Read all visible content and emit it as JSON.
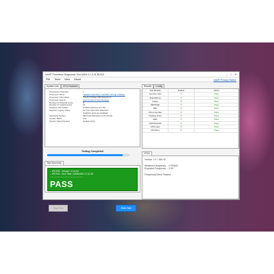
{
  "window": {
    "title": "Intel® Processor Diagnostic Tool 64bit 4.1.8.41 BUILD",
    "controls": [
      "–",
      "□",
      "✕"
    ]
  },
  "menu": {
    "items": [
      "File",
      "Tools",
      "View",
      "About"
    ],
    "privacy_notice": "Intel® Privacy Notice"
  },
  "left_tabs": [
    "System Info",
    "CPU Features"
  ],
  "system_info": [
    {
      "k": "Processors Detected",
      "v": "1",
      "link": false
    },
    {
      "k": "Processor Name",
      "v": "Intel(R) Core(TM) i7-10700F CPU @ 2.90GHz",
      "link": true
    },
    {
      "k": "Processor Information",
      "v": "Family 6 Model 165 Stepping 5",
      "link": false
    },
    {
      "k": "Processor Output",
      "v": "Click to launch Test Manager",
      "link": true
    },
    {
      "k": "Number of Physical Cores",
      "v": "8",
      "link": false
    },
    {
      "k": "Number of Logical Cores",
      "v": "16",
      "link": false
    },
    {
      "k": "Graphics Information",
      "v": "NVIDIA GeForce GT 710",
      "link": false
    },
    {
      "k": "OpenGL Legacy Driver",
      "v": "No Test Intel GPU Detected",
      "link": false
    },
    {
      "k": "",
      "v": "Graphics tests are disabled",
      "link": false
    },
    {
      "k": "Operating System",
      "v": "Microsoft Windows 11 Pro 64-bit",
      "link": false
    },
    {
      "k": "System BIOS",
      "v": "F.21",
      "link": false
    },
    {
      "k": "System Serial Number",
      "v": "Default string",
      "link": false
    }
  ],
  "status": {
    "text": "Testing Completed",
    "progress": 0.92
  },
  "summary_tab": "Test Summary",
  "summary": {
    "lines": [
      "-- IPDT64 - Version: 4.1.8.41",
      "-- IPDT64 - End Time: 10/08/2024 17:41:20",
      "--------------------------------------------"
    ],
    "result": "PASS"
  },
  "buttons": {
    "stop": "Stop Test",
    "start": "Start Test"
  },
  "right_tabs": [
    "Results",
    "Config"
  ],
  "results": {
    "columns": [
      "Test Module",
      "Enable",
      "CPU1"
    ],
    "rows": [
      {
        "module": "Genuine Intel",
        "enable": "☑",
        "cpu1": "Pass"
      },
      {
        "module": "BrandString",
        "enable": "☑",
        "cpu1": "Pass"
      },
      {
        "module": "Cache",
        "enable": "☑",
        "cpu1": "Pass"
      },
      {
        "module": "MMXSSE",
        "enable": "☑",
        "cpu1": "Pass"
      },
      {
        "module": "IMC",
        "enable": "☑",
        "cpu1": "Pass"
      },
      {
        "module": "Prime Number",
        "enable": "☑",
        "cpu1": "Pass"
      },
      {
        "module": "Floating Point",
        "enable": "☑",
        "cpu1": "Pass"
      },
      {
        "module": "Math",
        "enable": "☑",
        "cpu1": "Pass"
      },
      {
        "module": "GPUStressW",
        "enable": "☑",
        "cpu1": "Pass"
      },
      {
        "module": "CPULoad",
        "enable": "☑",
        "cpu1": "Pass"
      },
      {
        "module": "CPUFreq",
        "enable": "☑",
        "cpu1": "Pass"
      }
    ]
  },
  "cpu_tab": "CPU1",
  "cpu_log": [
    "Version 1.0.7.646 W",
    "",
    "  Measured frequency -- 2.903641",
    "  Expected Frequency -- 2.90",
    "",
    "FrequencyCheck Passed..."
  ]
}
